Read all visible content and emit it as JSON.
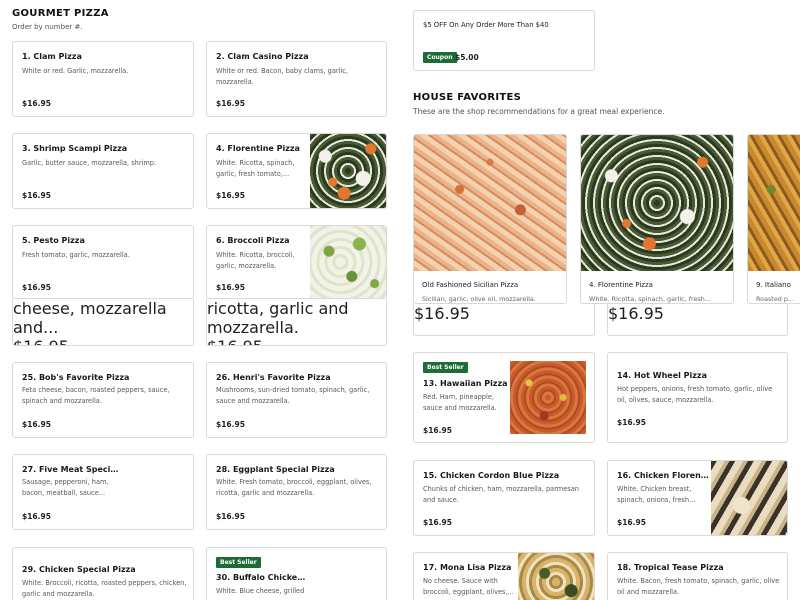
{
  "gourmet": {
    "title": "GOURMET PIZZA",
    "subtitle": "Order by number #.",
    "items": [
      {
        "name": "1. Clam Pizza",
        "desc": "White or red. Garlic, mozzarella.",
        "price": "$16.95"
      },
      {
        "name": "2. Clam Casino Pizza",
        "desc": "White or red. Bacon, baby clams, garlic, mozzarella.",
        "price": "$16.95"
      },
      {
        "name": "3. Shrimp Scampi Pizza",
        "desc": "Garlic, butter sauce, mozzarella, shrimp.",
        "price": "$16.95"
      },
      {
        "name": "4. Florentine Pizza",
        "desc": "White. Ricotta, spinach, garlic, fresh tomato,...",
        "price": "$16.95"
      },
      {
        "name": "5. Pesto Pizza",
        "desc": "Fresh tomato, garlic, mozzarella.",
        "price": "$16.95"
      },
      {
        "name": "6. Broccoli Pizza",
        "desc": "White. Ricotta, broccoli, garlic, mozzarella.",
        "price": "$16.95"
      },
      {
        "desc": "cheese, mozzarella and...",
        "price": "$16.95"
      },
      {
        "desc": "ricotta, garlic and mozzarella.",
        "price": "$16.95"
      },
      {
        "name": "25. Bob's Favorite Pizza",
        "desc": "Feta cheese, bacon, roasted peppers, sauce, spinach and mozzarella.",
        "price": "$16.95"
      },
      {
        "name": "26. Henri's Favorite Pizza",
        "desc": "Mushrooms, sun-dried tomato, spinach, garlic, sauce and mozzarella.",
        "price": "$16.95"
      },
      {
        "name": "27. Five Meat Special...",
        "desc": "Sausage, pepperoni, ham, bacon, meatball, sauce...",
        "price": "$16.95"
      },
      {
        "name": "28. Eggplant Special Pizza",
        "desc": "White. Fresh tomato, broccoli, eggplant, olives, ricotta, garlic and mozzarella.",
        "price": "$16.95"
      },
      {
        "name": "29. Chicken Special Pizza",
        "desc": "White. Broccoli, ricotta, roasted peppers, chicken, garlic and mozzarella."
      },
      {
        "badge": "Best Seller",
        "name": "30. Buffalo Chicken...",
        "desc": "White. Blue cheese, grilled"
      }
    ]
  },
  "coupon": {
    "text": "$5 OFF On Any Order More Than $40",
    "badge": "Coupon",
    "amount": "$5.00"
  },
  "house": {
    "title": "HOUSE FAVORITES",
    "subtitle": "These are the shop recommendations for a great meal experience.",
    "favorites": [
      {
        "name": "Old Fashioned Sicilian Pizza",
        "desc": "Sicilian, garlic, olive oil, mozzarella."
      },
      {
        "name": "4. Florentine Pizza",
        "desc": "White. Ricotta, spinach, garlic, fresh..."
      },
      {
        "name": "9. Italiano",
        "desc": "Roasted p..."
      }
    ],
    "items": [
      {
        "price": "$16.95"
      },
      {
        "price": "$16.95"
      },
      {
        "badge": "Best Seller",
        "name": "13. Hawaiian Pizza",
        "desc": "Red. Ham, pineapple, sauce and mozzarella.",
        "price": "$16.95"
      },
      {
        "name": "14. Hot Wheel Pizza",
        "desc": "Hot peppers, onions, fresh tomato, garlic, olive oil, olives, sauce, mozzarella.",
        "price": "$16.95"
      },
      {
        "name": "15. Chicken Cordon Blue Pizza",
        "desc": "Chunks of chicken, ham, mozzarella, parmesan and sauce.",
        "price": "$16.95"
      },
      {
        "name": "16. Chicken Florentin...",
        "desc": "White. Chicken breast, spinach, onions, fresh...",
        "price": "$16.95"
      },
      {
        "name": "17. Mona Lisa Pizza",
        "desc": "No cheese. Sauce with broccoli, eggplant, olives,..."
      },
      {
        "name": "18. Tropical Tease Pizza",
        "desc": "White. Bacon, fresh tomato, spinach, garlic, olive oil and mozzarella."
      }
    ]
  }
}
